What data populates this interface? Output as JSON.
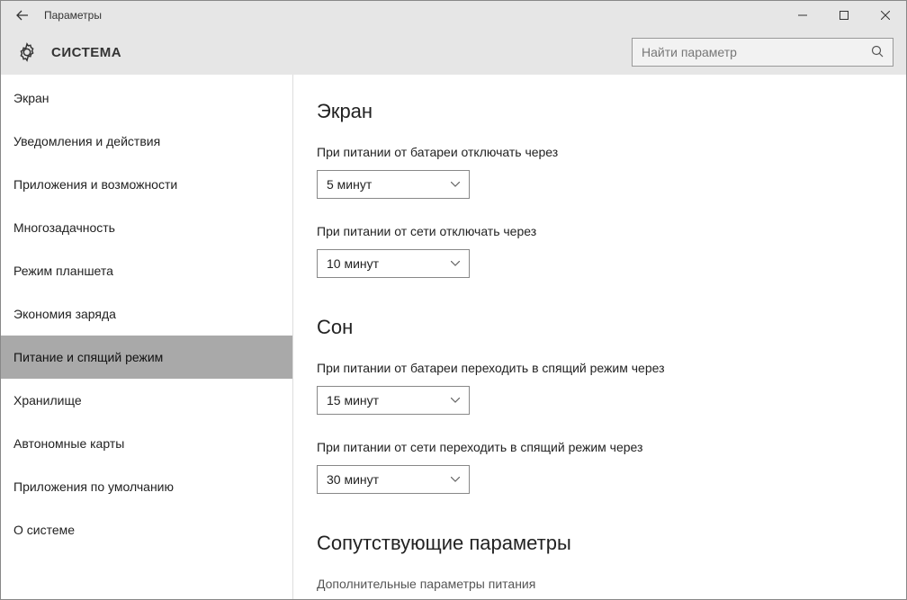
{
  "titlebar": {
    "title": "Параметры"
  },
  "header": {
    "title": "СИСТЕМА"
  },
  "search": {
    "placeholder": "Найти параметр"
  },
  "sidebar": {
    "items": [
      {
        "label": "Экран"
      },
      {
        "label": "Уведомления и действия"
      },
      {
        "label": "Приложения и возможности"
      },
      {
        "label": "Многозадачность"
      },
      {
        "label": "Режим планшета"
      },
      {
        "label": "Экономия заряда"
      },
      {
        "label": "Питание и спящий режим"
      },
      {
        "label": "Хранилище"
      },
      {
        "label": "Автономные карты"
      },
      {
        "label": "Приложения по умолчанию"
      },
      {
        "label": "О системе"
      }
    ],
    "selected_index": 6
  },
  "main": {
    "section_screen": {
      "title": "Экран",
      "battery_label": "При питании от батареи отключать через",
      "battery_value": "5 минут",
      "plugged_label": "При питании от сети отключать через",
      "plugged_value": "10 минут"
    },
    "section_sleep": {
      "title": "Сон",
      "battery_label": "При питании от батареи переходить в спящий режим через",
      "battery_value": "15 минут",
      "plugged_label": "При питании от сети переходить в спящий режим через",
      "plugged_value": "30 минут"
    },
    "section_related": {
      "title": "Сопутствующие параметры",
      "link": "Дополнительные параметры питания"
    }
  }
}
